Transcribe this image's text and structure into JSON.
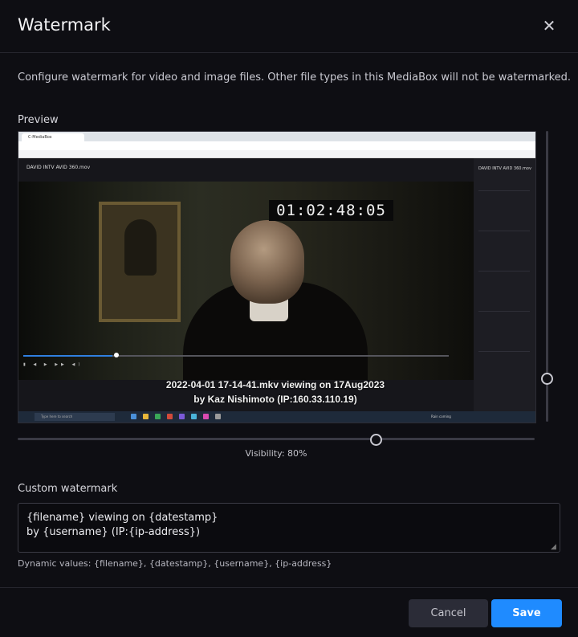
{
  "dialog": {
    "title": "Watermark",
    "close_icon": "close-icon",
    "description": "Configure watermark for video and image files. Other file types in this MediaBox will not be watermarked."
  },
  "preview": {
    "label": "Preview",
    "screenshot": {
      "tab_label": "C-MediaBox",
      "app_title": "DAVID INTV AVID 360.mov",
      "timecode": "01:02:48:05",
      "playback_progress": 0.21,
      "taskbar_search": "Type here to search",
      "tray_text": "Rain coming"
    },
    "watermark_line1": "2022-04-01 17-14-41.mkv viewing on 17Aug2023",
    "watermark_line2": "by Kaz Nishimoto (IP:160.33.110.19)",
    "vertical_position": 0.85
  },
  "visibility": {
    "value": 0.8,
    "label": "Visibility: 80%"
  },
  "custom_watermark": {
    "label": "Custom watermark",
    "value": "{filename} viewing on {datestamp}\nby {username} (IP:{ip-address})",
    "hint": "Dynamic values: {filename}, {datestamp}, {username}, {ip-address}"
  },
  "buttons": {
    "cancel": "Cancel",
    "save": "Save"
  },
  "colors": {
    "background": "#0e0e13",
    "accent": "#1f8bff",
    "cancel_bg": "#2b2c37"
  }
}
